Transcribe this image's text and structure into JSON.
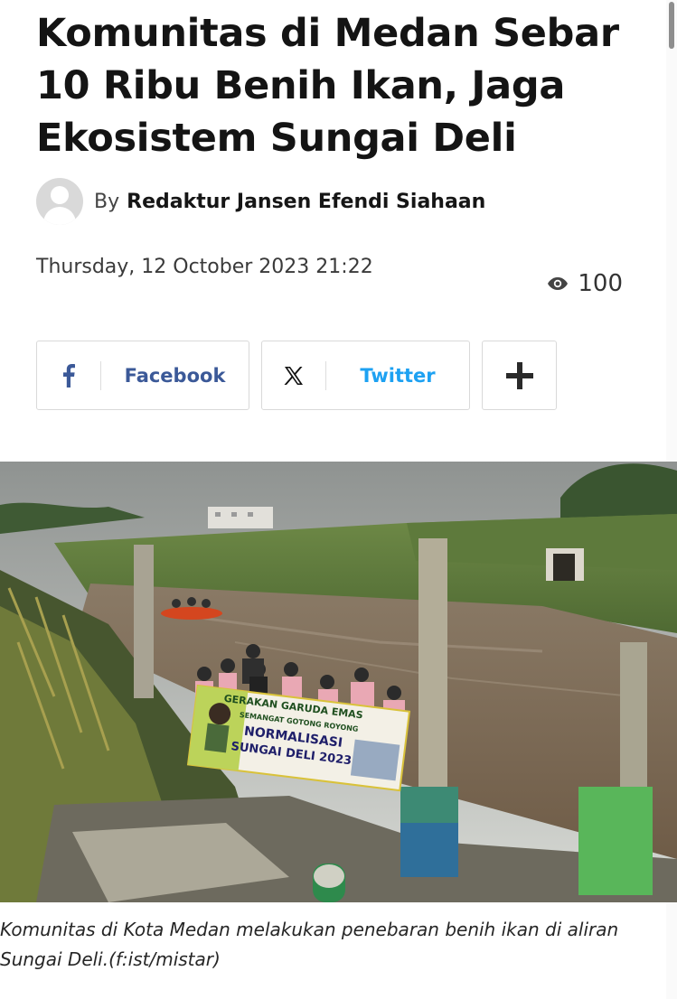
{
  "article": {
    "headline": "Komunitas di Medan Sebar 10 Ribu Benih Ikan, Jaga Ekosistem Sungai Deli",
    "byline_prefix": "By",
    "author": "Redaktur Jansen Efendi Siahaan",
    "date": "Thursday, 12 October 2023 21:22",
    "views": "100",
    "caption": "Komunitas di Kota Medan melakukan penebaran benih ikan di aliran Sungai Deli.(f:ist/mistar)"
  },
  "share": {
    "facebook_label": "Facebook",
    "twitter_label": "Twitter"
  },
  "banner": {
    "line1": "GERAKAN GARUDA EMAS",
    "line2": "SEMANGAT GOTONG ROYONG",
    "line3": "NORMALISASI",
    "line4": "SUNGAI DELI 2023"
  },
  "colors": {
    "facebook": "#3b5998",
    "twitter": "#1da1f2",
    "headline": "#141414"
  },
  "icons": {
    "avatar": "user-avatar-icon",
    "views": "eye-icon",
    "facebook": "facebook-f-icon",
    "twitter": "x-logo-icon",
    "more": "plus-icon"
  }
}
